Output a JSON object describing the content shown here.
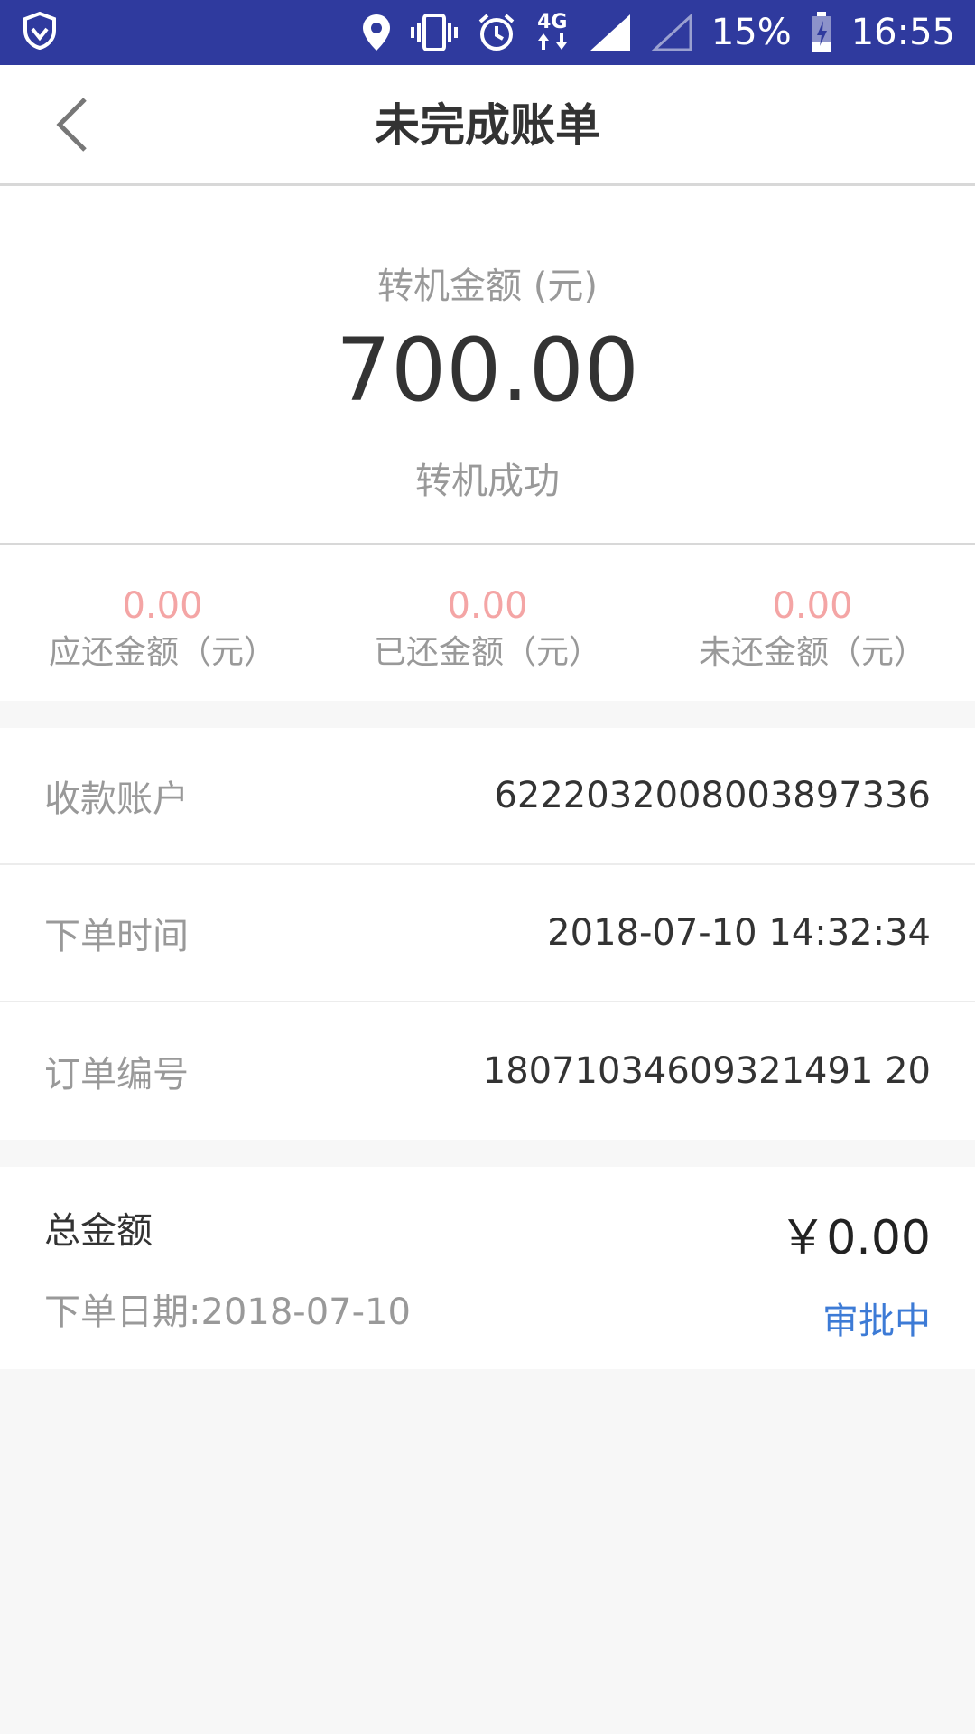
{
  "status_bar": {
    "battery_percent": "15%",
    "time": "16:55",
    "network": "4G",
    "icons": [
      "shield-icon",
      "location-icon",
      "vibrate-icon",
      "alarm-icon",
      "data-arrows-icon",
      "signal-icon",
      "signal-empty-icon",
      "battery-icon"
    ],
    "background": "#2f3a9e"
  },
  "nav": {
    "title": "未完成账单",
    "back_icon": "chevron-left-icon"
  },
  "summary": {
    "label": "转机金额 (元)",
    "amount": "700.00",
    "status": "转机成功"
  },
  "stats": [
    {
      "value": "0.00",
      "label": "应还金额（元）"
    },
    {
      "value": "0.00",
      "label": "已还金额（元）"
    },
    {
      "value": "0.00",
      "label": "未还金额（元）"
    }
  ],
  "details": [
    {
      "label": "收款账户",
      "value": "6222032008003897336"
    },
    {
      "label": "下单时间",
      "value": "2018-07-10 14:32:34"
    },
    {
      "label": "订单编号",
      "value": "18071034609321491 20"
    }
  ],
  "total": {
    "label": "总金额",
    "amount": "￥0.00",
    "date": "下单日期:2018-07-10",
    "status": "审批中",
    "status_color": "#3d7bd6"
  },
  "colors": {
    "stat_value": "#f4a5a5",
    "page_background": "#f7f7f7"
  }
}
